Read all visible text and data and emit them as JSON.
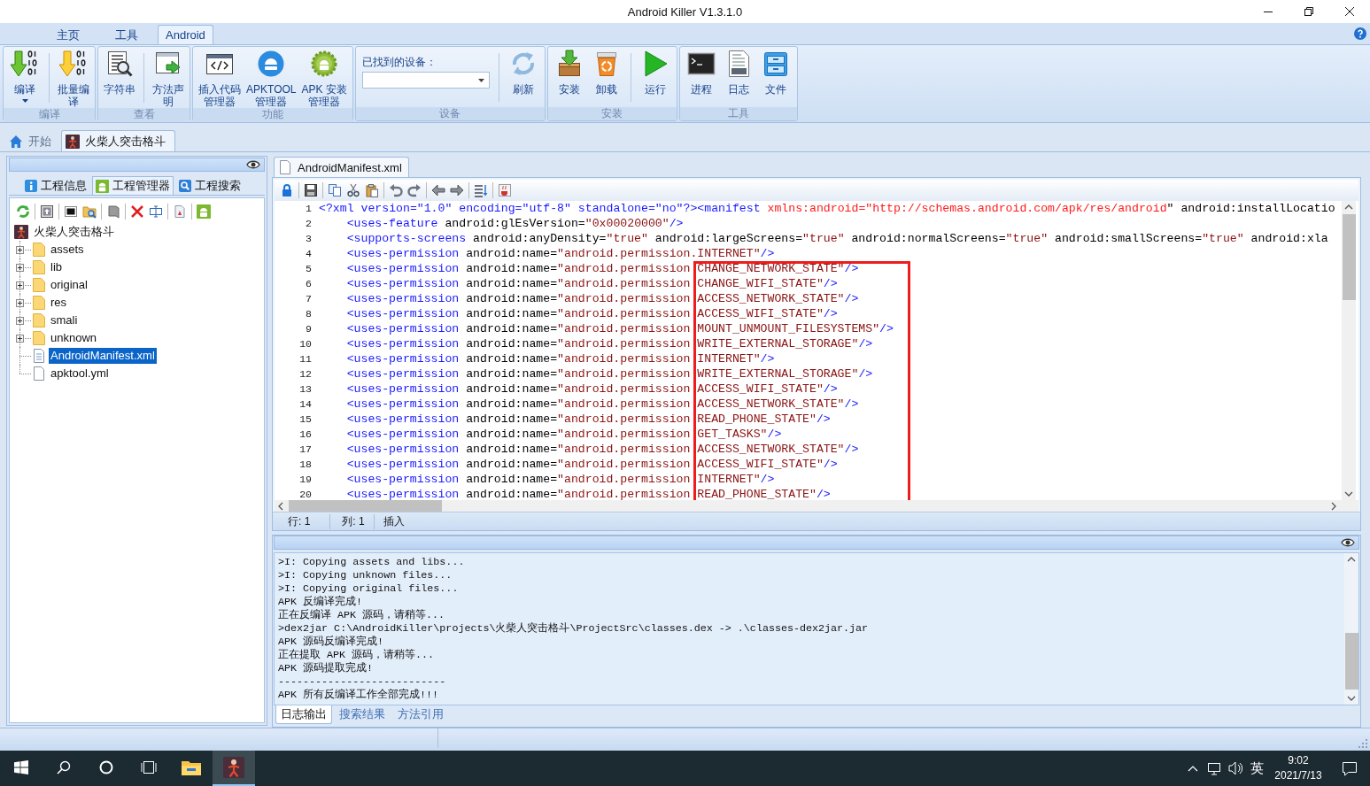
{
  "window": {
    "title": "Android Killer V1.3.1.0"
  },
  "ribbon": {
    "tabs": [
      {
        "label": "主页",
        "selected": false
      },
      {
        "label": "工具",
        "selected": false
      },
      {
        "label": "Android",
        "selected": true
      }
    ],
    "groups": [
      {
        "label": "编译",
        "items": [
          {
            "kind": "button",
            "label_lines": [
              "编译"
            ],
            "dropdown": true
          },
          {
            "kind": "separator"
          },
          {
            "kind": "button",
            "label_lines": [
              "批量编",
              "译"
            ],
            "dropdown": false
          }
        ]
      },
      {
        "label": "查看",
        "items": [
          {
            "kind": "button",
            "label_lines": [
              "字符串"
            ],
            "dropdown": false
          },
          {
            "kind": "separator"
          },
          {
            "kind": "button",
            "label_lines": [
              "方法声",
              "明"
            ],
            "dropdown": false
          }
        ]
      },
      {
        "label": "功能",
        "items": [
          {
            "kind": "button",
            "label_lines": [
              "插入代码",
              "管理器"
            ],
            "dropdown": false
          },
          {
            "kind": "button",
            "label_lines": [
              "APKTOOL",
              "管理器"
            ],
            "dropdown": false
          },
          {
            "kind": "button",
            "label_lines": [
              "APK 安装",
              "管理器"
            ],
            "dropdown": false
          }
        ]
      },
      {
        "label": "设备",
        "items": [
          {
            "kind": "picker",
            "label": "已找到的设备："
          },
          {
            "kind": "separator"
          },
          {
            "kind": "button",
            "label_lines": [
              "刷新"
            ],
            "dropdown": false
          }
        ]
      },
      {
        "label": "安装",
        "items": [
          {
            "kind": "button",
            "label_lines": [
              "安装"
            ],
            "dropdown": false
          },
          {
            "kind": "button",
            "label_lines": [
              "卸载"
            ],
            "dropdown": false
          },
          {
            "kind": "separator"
          },
          {
            "kind": "button",
            "label_lines": [
              "运行"
            ],
            "dropdown": false
          }
        ]
      },
      {
        "label": "工具",
        "items": [
          {
            "kind": "button",
            "label_lines": [
              "进程"
            ],
            "dropdown": false
          },
          {
            "kind": "button",
            "label_lines": [
              "日志"
            ],
            "dropdown": false
          },
          {
            "kind": "button",
            "label_lines": [
              "文件"
            ],
            "dropdown": false
          }
        ]
      }
    ]
  },
  "document_tabs": [
    {
      "label": "开始",
      "selected": false
    },
    {
      "label": "火柴人突击格斗",
      "selected": true
    }
  ],
  "project_panel": {
    "tabs": [
      {
        "label": "工程信息",
        "selected": false
      },
      {
        "label": "工程管理器",
        "selected": true
      },
      {
        "label": "工程搜索",
        "selected": false
      }
    ],
    "tree": {
      "label": "火柴人突击格斗",
      "selected": false,
      "children": [
        {
          "kind": "folder",
          "label": "assets",
          "expanded": false,
          "selected": false
        },
        {
          "kind": "folder",
          "label": "lib",
          "expanded": false,
          "selected": false
        },
        {
          "kind": "folder",
          "label": "original",
          "expanded": false,
          "selected": false
        },
        {
          "kind": "folder",
          "label": "res",
          "expanded": false,
          "selected": false
        },
        {
          "kind": "folder",
          "label": "smali",
          "expanded": false,
          "selected": false
        },
        {
          "kind": "folder",
          "label": "unknown",
          "expanded": false,
          "selected": false
        },
        {
          "kind": "xml",
          "label": "AndroidManifest.xml",
          "selected": true
        },
        {
          "kind": "file",
          "label": "apktool.yml",
          "selected": false
        }
      ]
    }
  },
  "editor": {
    "tabs": [
      {
        "label": "AndroidManifest.xml",
        "selected": true
      }
    ],
    "code": {
      "lines": [
        {
          "number": "1",
          "marked": false,
          "tokens": [
            {
              "kind": "declaration",
              "text": "<?xml version=\"1.0\" encoding=\"utf-8\" standalone=\"no\"?>"
            },
            {
              "kind": "tag",
              "text": "<manifest"
            },
            {
              "kind": "namespace",
              "text": " xmlns:android="
            },
            {
              "kind": "namespace",
              "text": "\"http://schemas.android.com/apk/res/android"
            },
            {
              "kind": "attr",
              "text": "\" android:installLocatio"
            }
          ],
          "children": [
            {
              "number": "2",
              "marked": false,
              "tokens": [
                {
                  "kind": "tag",
                  "text": "<uses-feature"
                },
                {
                  "kind": "attr",
                  "text": " android:glEsVersion="
                },
                {
                  "kind": "value",
                  "text": "\"0x00020000\""
                },
                {
                  "kind": "tag",
                  "text": "/>"
                }
              ]
            },
            {
              "number": "3",
              "marked": false,
              "tokens": [
                {
                  "kind": "tag",
                  "text": "<supports-screens"
                },
                {
                  "kind": "attr",
                  "text": " android:anyDensity="
                },
                {
                  "kind": "value",
                  "text": "\"true\""
                },
                {
                  "kind": "attr",
                  "text": " android:largeScreens="
                },
                {
                  "kind": "value",
                  "text": "\"true\""
                },
                {
                  "kind": "attr",
                  "text": " android:normalScreens="
                },
                {
                  "kind": "value",
                  "text": "\"true\""
                },
                {
                  "kind": "attr",
                  "text": " android:smallScreens="
                },
                {
                  "kind": "value",
                  "text": "\"true\""
                },
                {
                  "kind": "attr",
                  "text": " android:xla"
                }
              ]
            },
            {
              "number": "4",
              "marked": false,
              "tokens": [
                {
                  "kind": "tag",
                  "text": "<uses-permission"
                },
                {
                  "kind": "attr",
                  "text": " android:name="
                },
                {
                  "kind": "value",
                  "text": "\"android.permission.INTERNET\""
                },
                {
                  "kind": "tag",
                  "text": "/>"
                }
              ]
            },
            {
              "number": "5",
              "marked": true,
              "tokens": [
                {
                  "kind": "tag",
                  "text": "<uses-permission"
                },
                {
                  "kind": "attr",
                  "text": " android:name="
                },
                {
                  "kind": "value",
                  "text": "\"android.permission"
                }
              ],
              "tail": [
                {
                  "kind": "value",
                  "text": "CHANGE_NETWORK_STATE\""
                },
                {
                  "kind": "tag",
                  "text": "/>"
                }
              ]
            },
            {
              "number": "6",
              "marked": true,
              "tokens": [
                {
                  "kind": "tag",
                  "text": "<uses-permission"
                },
                {
                  "kind": "attr",
                  "text": " android:name="
                },
                {
                  "kind": "value",
                  "text": "\"android.permission"
                }
              ],
              "tail": [
                {
                  "kind": "value",
                  "text": "CHANGE_WIFI_STATE\""
                },
                {
                  "kind": "tag",
                  "text": "/>"
                }
              ]
            },
            {
              "number": "7",
              "marked": true,
              "tokens": [
                {
                  "kind": "tag",
                  "text": "<uses-permission"
                },
                {
                  "kind": "attr",
                  "text": " android:name="
                },
                {
                  "kind": "value",
                  "text": "\"android.permission"
                }
              ],
              "tail": [
                {
                  "kind": "value",
                  "text": "ACCESS_NETWORK_STATE\""
                },
                {
                  "kind": "tag",
                  "text": "/>"
                }
              ]
            },
            {
              "number": "8",
              "marked": true,
              "tokens": [
                {
                  "kind": "tag",
                  "text": "<uses-permission"
                },
                {
                  "kind": "attr",
                  "text": " android:name="
                },
                {
                  "kind": "value",
                  "text": "\"android.permission"
                }
              ],
              "tail": [
                {
                  "kind": "value",
                  "text": "ACCESS_WIFI_STATE\""
                },
                {
                  "kind": "tag",
                  "text": "/>"
                }
              ]
            },
            {
              "number": "9",
              "marked": true,
              "tokens": [
                {
                  "kind": "tag",
                  "text": "<uses-permission"
                },
                {
                  "kind": "attr",
                  "text": " android:name="
                },
                {
                  "kind": "value",
                  "text": "\"android.permission"
                }
              ],
              "tail": [
                {
                  "kind": "value",
                  "text": "MOUNT_UNMOUNT_FILESYSTEMS\""
                },
                {
                  "kind": "tag",
                  "text": "/>"
                }
              ]
            },
            {
              "number": "10",
              "marked": true,
              "tokens": [
                {
                  "kind": "tag",
                  "text": "<uses-permission"
                },
                {
                  "kind": "attr",
                  "text": " android:name="
                },
                {
                  "kind": "value",
                  "text": "\"android.permission"
                }
              ],
              "tail": [
                {
                  "kind": "value",
                  "text": "WRITE_EXTERNAL_STORAGE\""
                },
                {
                  "kind": "tag",
                  "text": "/>"
                }
              ]
            },
            {
              "number": "11",
              "marked": true,
              "tokens": [
                {
                  "kind": "tag",
                  "text": "<uses-permission"
                },
                {
                  "kind": "attr",
                  "text": " android:name="
                },
                {
                  "kind": "value",
                  "text": "\"android.permission"
                }
              ],
              "tail": [
                {
                  "kind": "value",
                  "text": "INTERNET\""
                },
                {
                  "kind": "tag",
                  "text": "/>"
                }
              ]
            },
            {
              "number": "12",
              "marked": true,
              "tokens": [
                {
                  "kind": "tag",
                  "text": "<uses-permission"
                },
                {
                  "kind": "attr",
                  "text": " android:name="
                },
                {
                  "kind": "value",
                  "text": "\"android.permission"
                }
              ],
              "tail": [
                {
                  "kind": "value",
                  "text": "WRITE_EXTERNAL_STORAGE\""
                },
                {
                  "kind": "tag",
                  "text": "/>"
                }
              ]
            },
            {
              "number": "13",
              "marked": true,
              "tokens": [
                {
                  "kind": "tag",
                  "text": "<uses-permission"
                },
                {
                  "kind": "attr",
                  "text": " android:name="
                },
                {
                  "kind": "value",
                  "text": "\"android.permission"
                }
              ],
              "tail": [
                {
                  "kind": "value",
                  "text": "ACCESS_WIFI_STATE\""
                },
                {
                  "kind": "tag",
                  "text": "/>"
                }
              ]
            },
            {
              "number": "14",
              "marked": true,
              "tokens": [
                {
                  "kind": "tag",
                  "text": "<uses-permission"
                },
                {
                  "kind": "attr",
                  "text": " android:name="
                },
                {
                  "kind": "value",
                  "text": "\"android.permission"
                }
              ],
              "tail": [
                {
                  "kind": "value",
                  "text": "ACCESS_NETWORK_STATE\""
                },
                {
                  "kind": "tag",
                  "text": "/>"
                }
              ]
            },
            {
              "number": "15",
              "marked": true,
              "tokens": [
                {
                  "kind": "tag",
                  "text": "<uses-permission"
                },
                {
                  "kind": "attr",
                  "text": " android:name="
                },
                {
                  "kind": "value",
                  "text": "\"android.permission"
                }
              ],
              "tail": [
                {
                  "kind": "value",
                  "text": "READ_PHONE_STATE\""
                },
                {
                  "kind": "tag",
                  "text": "/>"
                }
              ]
            },
            {
              "number": "16",
              "marked": true,
              "tokens": [
                {
                  "kind": "tag",
                  "text": "<uses-permission"
                },
                {
                  "kind": "attr",
                  "text": " android:name="
                },
                {
                  "kind": "value",
                  "text": "\"android.permission"
                }
              ],
              "tail": [
                {
                  "kind": "value",
                  "text": "GET_TASKS\""
                },
                {
                  "kind": "tag",
                  "text": "/>"
                }
              ]
            },
            {
              "number": "17",
              "marked": true,
              "tokens": [
                {
                  "kind": "tag",
                  "text": "<uses-permission"
                },
                {
                  "kind": "attr",
                  "text": " android:name="
                },
                {
                  "kind": "value",
                  "text": "\"android.permission"
                }
              ],
              "tail": [
                {
                  "kind": "value",
                  "text": "ACCESS_NETWORK_STATE\""
                },
                {
                  "kind": "tag",
                  "text": "/>"
                }
              ]
            },
            {
              "number": "18",
              "marked": true,
              "tokens": [
                {
                  "kind": "tag",
                  "text": "<uses-permission"
                },
                {
                  "kind": "attr",
                  "text": " android:name="
                },
                {
                  "kind": "value",
                  "text": "\"android.permission"
                }
              ],
              "tail": [
                {
                  "kind": "value",
                  "text": "ACCESS_WIFI_STATE\""
                },
                {
                  "kind": "tag",
                  "text": "/>"
                }
              ]
            },
            {
              "number": "19",
              "marked": true,
              "tokens": [
                {
                  "kind": "tag",
                  "text": "<uses-permission"
                },
                {
                  "kind": "attr",
                  "text": " android:name="
                },
                {
                  "kind": "value",
                  "text": "\"android.permission"
                }
              ],
              "tail": [
                {
                  "kind": "value",
                  "text": "INTERNET\""
                },
                {
                  "kind": "tag",
                  "text": "/>"
                }
              ]
            },
            {
              "number": "20",
              "marked": true,
              "tokens": [
                {
                  "kind": "tag",
                  "text": "<uses-permission"
                },
                {
                  "kind": "attr",
                  "text": " android:name="
                },
                {
                  "kind": "value",
                  "text": "\"android.permission"
                }
              ],
              "tail": [
                {
                  "kind": "value",
                  "text": "READ_PHONE_STATE\""
                },
                {
                  "kind": "tag",
                  "text": "/>"
                }
              ]
            }
          ]
        }
      ]
    },
    "status": {
      "line": "行: 1",
      "column": "列: 1",
      "mode": "插入"
    }
  },
  "log": {
    "lines": [
      ">I: Copying assets and libs...",
      ">I: Copying unknown files...",
      ">I: Copying original files...",
      "APK 反编译完成!",
      "正在反编译 APK 源码，请稍等...",
      ">dex2jar C:\\AndroidKiller\\projects\\火柴人突击格斗\\ProjectSrc\\classes.dex -> .\\classes-dex2jar.jar",
      "APK 源码反编译完成!",
      "正在提取 APK 源码，请稍等...",
      "APK 源码提取完成!",
      "---------------------------",
      "APK 所有反编译工作全部完成!!!"
    ],
    "tabs": [
      {
        "label": "日志输出",
        "selected": true
      },
      {
        "label": "搜索结果",
        "selected": false
      },
      {
        "label": "方法引用",
        "selected": false
      }
    ]
  },
  "taskbar": {
    "apps": [
      {
        "selected": false
      },
      {
        "selected": true
      }
    ],
    "input_language": "英",
    "time": "9:02",
    "date": "2021/7/13"
  }
}
